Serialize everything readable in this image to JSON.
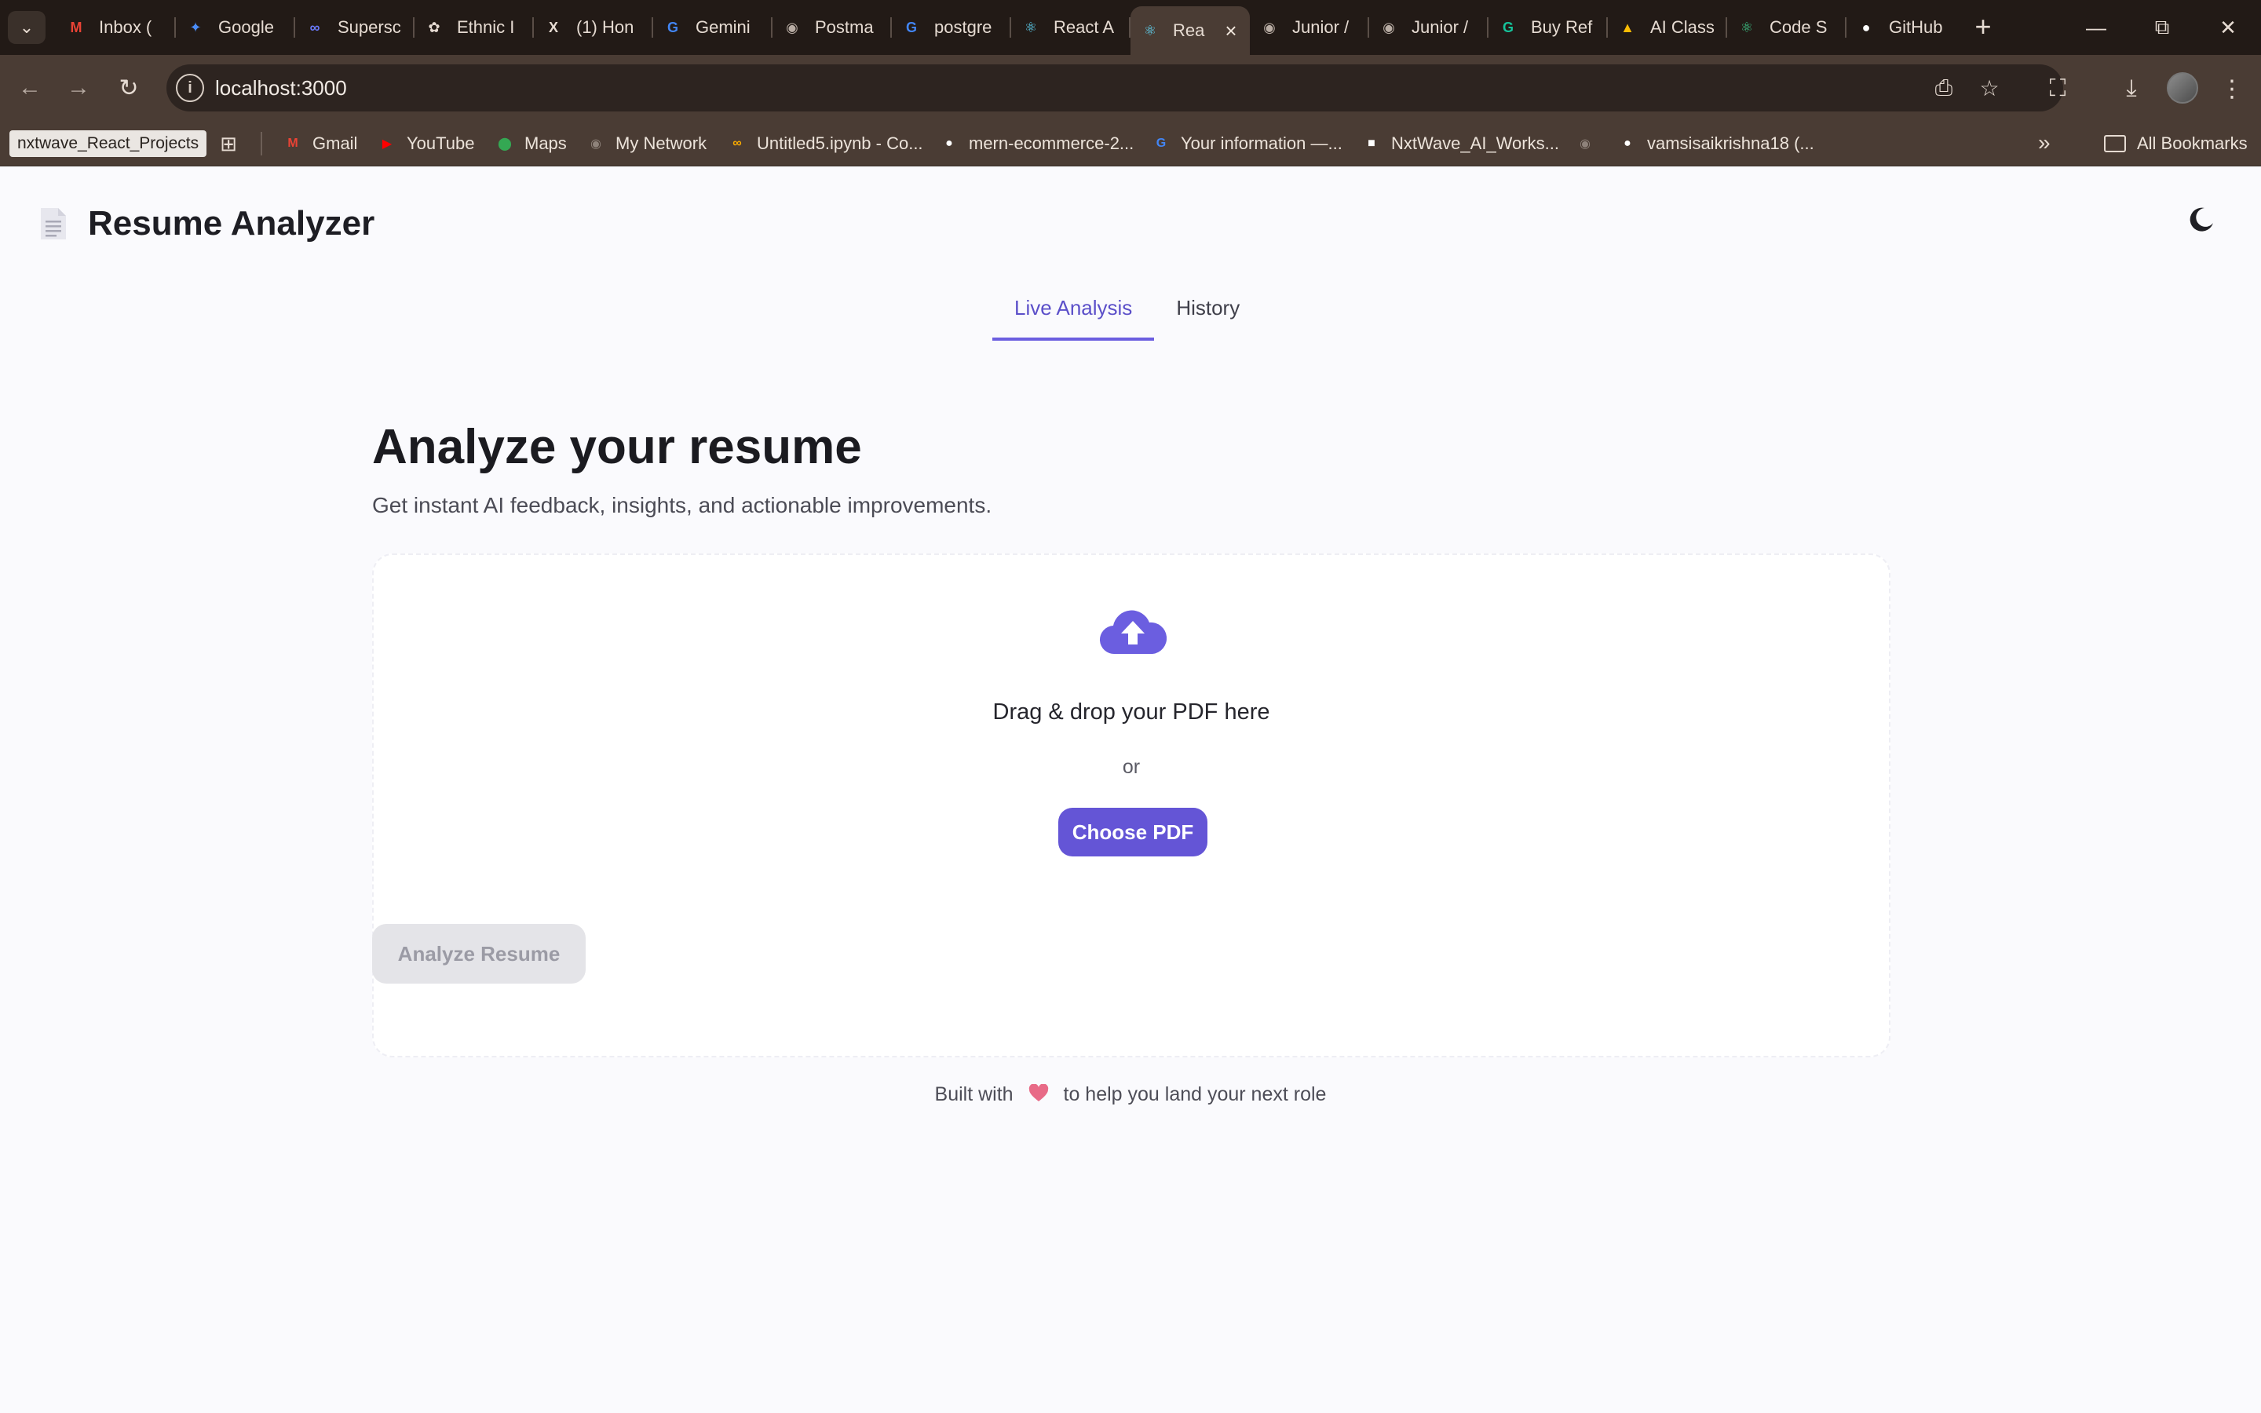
{
  "browser": {
    "tabs": [
      {
        "label": "Inbox (",
        "icon": "gmail-icon",
        "color": "#ea4335"
      },
      {
        "label": "Google",
        "icon": "gemini-star-icon",
        "color": "#4a8cf7"
      },
      {
        "label": "Supersc",
        "icon": "superset-icon",
        "color": "#6b7cff"
      },
      {
        "label": "Ethnic I",
        "icon": "openai-icon",
        "color": "#e6dbd2"
      },
      {
        "label": "(1) Hon",
        "icon": "x-icon",
        "color": "#e6dbd2"
      },
      {
        "label": "Gemini",
        "icon": "google-icon",
        "color": "#4285f4"
      },
      {
        "label": "Postma",
        "icon": "globe-icon",
        "color": "#b9ada4"
      },
      {
        "label": "postgre",
        "icon": "google-icon",
        "color": "#4285f4"
      },
      {
        "label": "React A",
        "icon": "react-icon",
        "color": "#61dafb"
      },
      {
        "label": "Rea",
        "icon": "react-icon",
        "color": "#61dafb",
        "active": true
      },
      {
        "label": "Junior /",
        "icon": "globe-icon",
        "color": "#b9ada4"
      },
      {
        "label": "Junior /",
        "icon": "globe-icon",
        "color": "#b9ada4"
      },
      {
        "label": "Buy Ref",
        "icon": "grammarly-icon",
        "color": "#15c39a"
      },
      {
        "label": "AI Class",
        "icon": "drive-icon",
        "color": "#fbbc04"
      },
      {
        "label": "Code S",
        "icon": "react-icon",
        "color": "#3ecf8e"
      },
      {
        "label": "GitHub",
        "icon": "github-icon",
        "color": "#ffffff"
      }
    ],
    "url": "localhost:3000",
    "bookmarks_folder": "nxtwave_React_Projects",
    "bookmarks": [
      {
        "label": "Gmail",
        "icon": "gmail-icon",
        "color": "#ea4335"
      },
      {
        "label": "YouTube",
        "icon": "youtube-icon",
        "color": "#ff0000"
      },
      {
        "label": "Maps",
        "icon": "maps-icon",
        "color": "#34a853"
      },
      {
        "label": "My Network",
        "icon": "globe-icon",
        "color": "#8f837b"
      },
      {
        "label": "Untitled5.ipynb - Co...",
        "icon": "colab-icon",
        "color": "#f9ab00"
      },
      {
        "label": "mern-ecommerce-2...",
        "icon": "github-icon",
        "color": "#ffffff"
      },
      {
        "label": "Your information —...",
        "icon": "google-icon",
        "color": "#4285f4"
      },
      {
        "label": "NxtWave_AI_Works...",
        "icon": "nxtwave-icon",
        "color": "#ffffff"
      },
      {
        "label": "",
        "icon": "globe-icon",
        "color": "#8f837b"
      },
      {
        "label": "vamsisaikrishna18 (...",
        "icon": "github-icon",
        "color": "#ffffff"
      }
    ],
    "all_bookmarks": "All Bookmarks"
  },
  "app": {
    "title": "Resume Analyzer",
    "tabs": [
      {
        "label": "Live Analysis",
        "active": true
      },
      {
        "label": "History",
        "active": false
      }
    ],
    "heading": "Analyze your resume",
    "subheading": "Get instant AI feedback, insights, and actionable improvements.",
    "dropzone": {
      "drop_text": "Drag & drop your PDF here",
      "or_text": "or",
      "choose_button": "Choose PDF"
    },
    "analyze_button": "Analyze Resume",
    "footer": {
      "prefix": "Built with",
      "suffix": "to help you land your next role"
    },
    "colors": {
      "accent": "#6455d6",
      "tab_active": "#5b4fc9",
      "disabled_button_bg": "#e4e4e8",
      "heart": "#e86a87"
    }
  }
}
